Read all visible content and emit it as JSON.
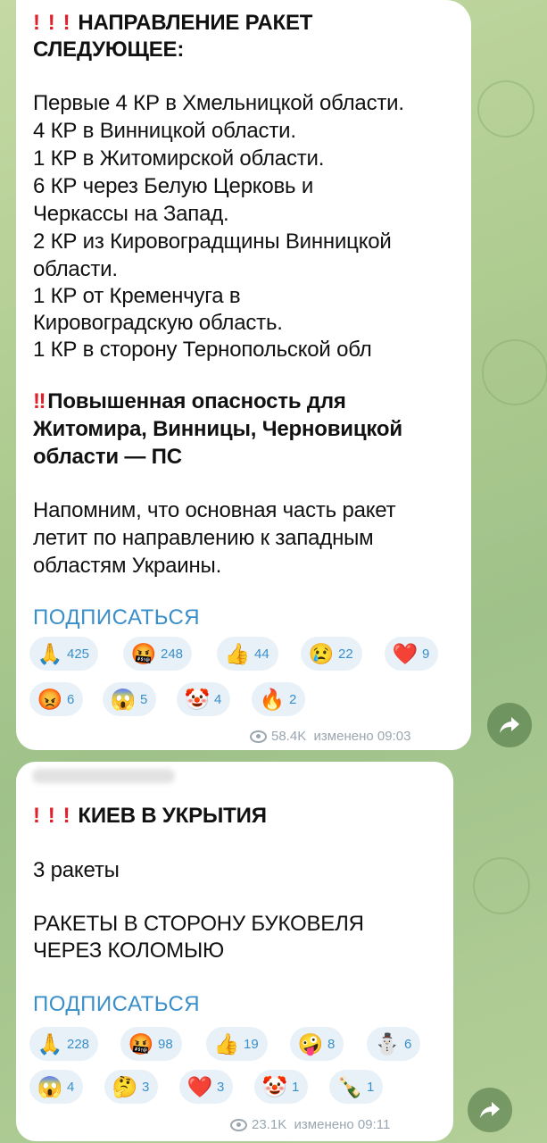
{
  "post1": {
    "header_line1": "НАПРАВЛЕНИЕ РАКЕТ",
    "header_line2": "СЛЕДУЮЩЕЕ:",
    "lines": [
      "Первые 4 КР в Хмельницкой области.",
      "4 КР в Винницкой области.",
      "1 КР в Житомирской области.",
      "6 КР через Белую Церковь и",
      "Черкассы на Запад.",
      "2 КР из Кировоградщины Винницкой",
      "области.",
      "1 КР от Кременчуга в",
      "Кировоградскую область.",
      "1 КР в сторону Тернопольской обл"
    ],
    "warning_line1": "Повышенная опасность для",
    "warning_line2": "Житомира, Винницы, Черновицкой",
    "warning_line3": "области — ПС",
    "reminder": [
      "Напомним, что основная часть ракет",
      "летит по направлению к западным",
      "областям Украины."
    ],
    "subscribe": "ПОДПИСАТЬСЯ",
    "reactions": [
      {
        "emoji": "🙏",
        "count": "425"
      },
      {
        "emoji": "🤬",
        "count": "248"
      },
      {
        "emoji": "👍",
        "count": "44"
      },
      {
        "emoji": "😢",
        "count": "22"
      },
      {
        "emoji": "❤️",
        "count": "9"
      },
      {
        "emoji": "😡",
        "count": "6"
      },
      {
        "emoji": "😱",
        "count": "5"
      },
      {
        "emoji": "🤡",
        "count": "4"
      },
      {
        "emoji": "🔥",
        "count": "2"
      }
    ],
    "views": "58.4K",
    "edited": "изменено 09:03"
  },
  "post2": {
    "header": "КИЕВ В УКРЫТИЯ",
    "line1": "3 ракеты",
    "line2": "РАКЕТЫ В СТОРОНУ БУКОВЕЛЯ",
    "line3": "ЧЕРЕЗ КОЛОМЫЮ",
    "subscribe": "ПОДПИСАТЬСЯ",
    "reactions": [
      {
        "emoji": "🙏",
        "count": "228"
      },
      {
        "emoji": "🤬",
        "count": "98"
      },
      {
        "emoji": "👍",
        "count": "19"
      },
      {
        "emoji": "🤪",
        "count": "8"
      },
      {
        "emoji": "⛄",
        "count": "6"
      },
      {
        "emoji": "😱",
        "count": "4"
      },
      {
        "emoji": "🤔",
        "count": "3"
      },
      {
        "emoji": "❤️",
        "count": "3"
      },
      {
        "emoji": "🤡",
        "count": "1"
      },
      {
        "emoji": "🍾",
        "count": "1"
      }
    ],
    "views": "23.1K",
    "edited": "изменено 09:11"
  },
  "exclaim": "!",
  "double_exclaim": "‼",
  "icons": {
    "share": "share-arrow-icon",
    "views": "eye-icon"
  }
}
